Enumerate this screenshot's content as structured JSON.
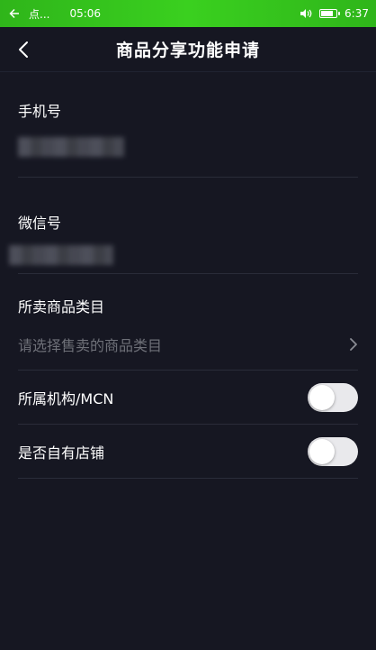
{
  "status_bar": {
    "app_text": "点...",
    "time_left": "05:06",
    "time_right": "6:37",
    "background": "#35c41d",
    "battery_level": 0.7
  },
  "nav": {
    "title": "商品分享功能申请",
    "back_icon": "chevron-left-icon"
  },
  "form": {
    "phone": {
      "label": "手机号"
    },
    "wechat": {
      "label": "微信号"
    },
    "category": {
      "label": "所卖商品类目",
      "placeholder": "请选择售卖的商品类目",
      "icon": "chevron-right-icon"
    },
    "mcn": {
      "label": "所属机构/MCN",
      "enabled": false
    },
    "own_store": {
      "label": "是否自有店铺",
      "enabled": false
    }
  },
  "colors": {
    "background": "#161722",
    "divider": "#2a2c39",
    "placeholder": "#6e7078",
    "switch_track": "#e9e9ec"
  }
}
